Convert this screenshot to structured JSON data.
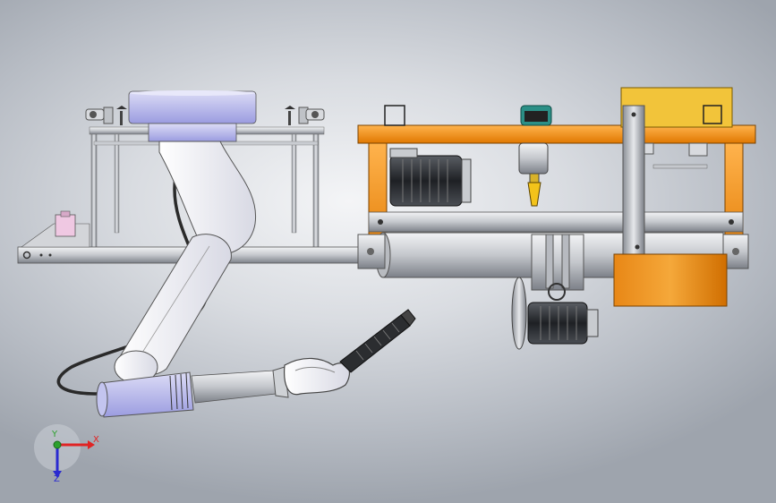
{
  "viewport": {
    "background_colors": [
      "#f4f5f7",
      "#d9dce1",
      "#b7bcc4",
      "#9ea4ad"
    ],
    "model_colors": {
      "orange_frame": "#f18b1f",
      "yellow_block": "#f2c43a",
      "robot_white": "#f4f4f8",
      "robot_purple": "#b7b8ee",
      "steel": "#c4c7cc"
    }
  },
  "triad": {
    "x_label": "X",
    "y_label": "Y",
    "z_label": "Z",
    "x_color": "#e02424",
    "y_color": "#2ca02c",
    "z_color": "#2a2ad0"
  }
}
